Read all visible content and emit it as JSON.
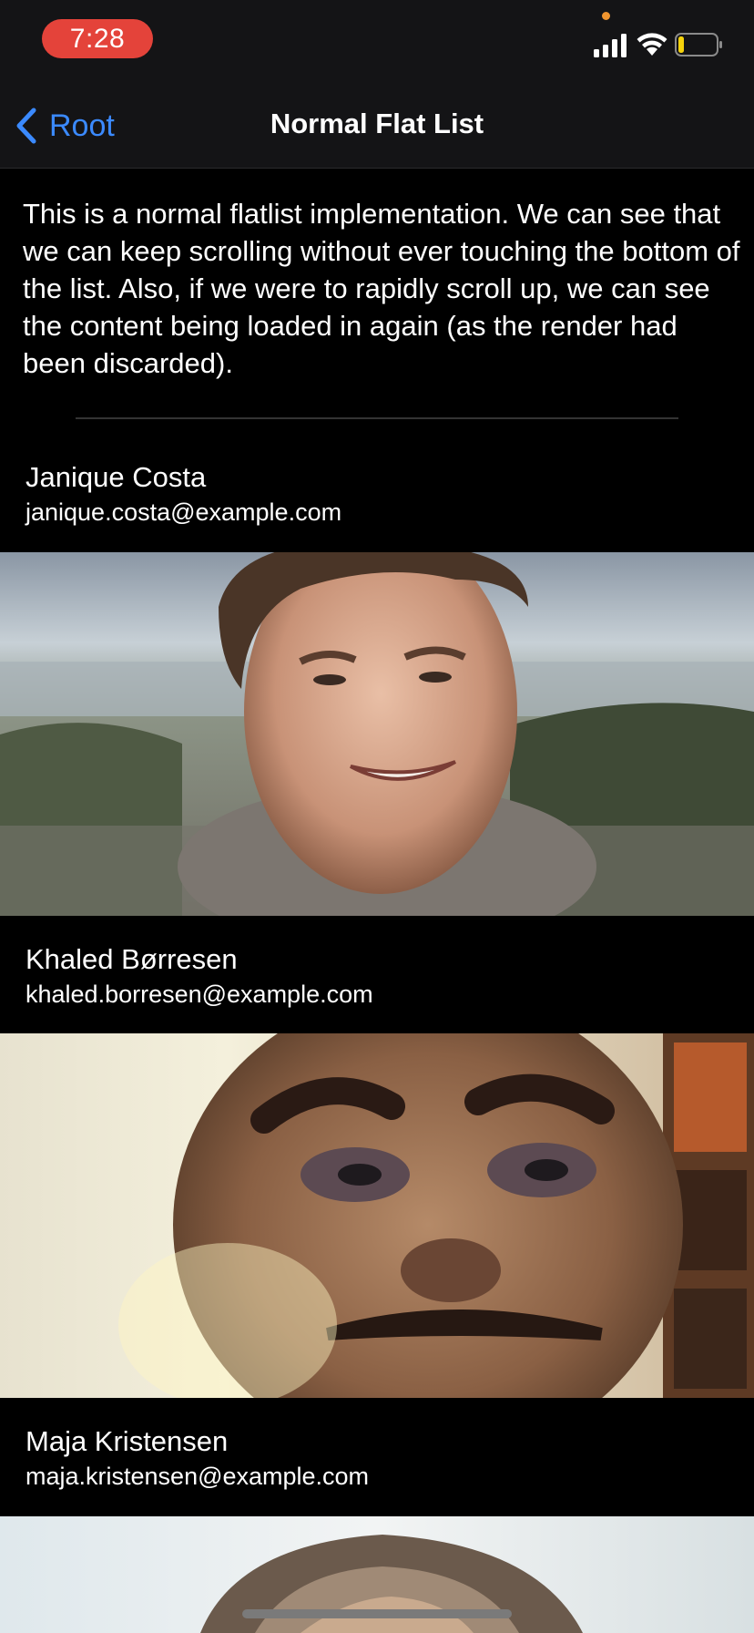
{
  "status_bar": {
    "time": "7:28",
    "battery_level": 0.15
  },
  "nav": {
    "back_label": "Root",
    "title": "Normal Flat List"
  },
  "intro_text": "This is a normal flatlist implementation. We can see that we can keep scrolling without ever touching the bottom of the list. Also, if we were to rapidly scroll up, we can see the content being loaded in again (as the render had been discarded).",
  "people": [
    {
      "name": "Janique Costa",
      "email": "janique.costa@example.com"
    },
    {
      "name": "Khaled Børresen",
      "email": "khaled.borresen@example.com"
    },
    {
      "name": "Maja Kristensen",
      "email": "maja.kristensen@example.com"
    }
  ],
  "colors": {
    "accent": "#3b8aff",
    "time_pill": "#e4433a",
    "background": "#000000",
    "bar": "#141416"
  }
}
